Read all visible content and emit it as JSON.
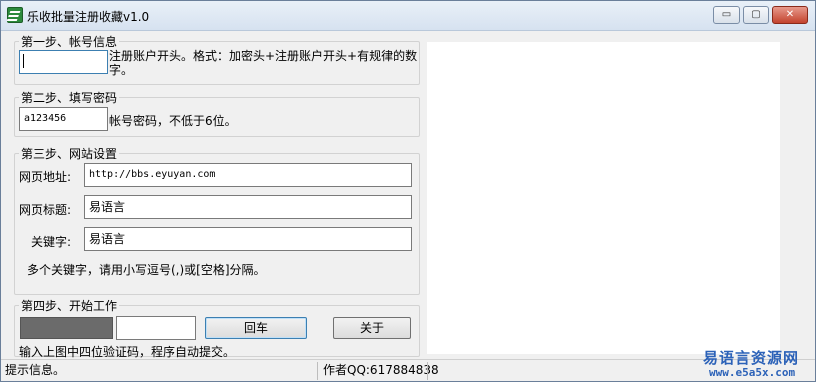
{
  "window": {
    "title": "乐收批量注册收藏v1.0",
    "icon": "app-logo-icon",
    "controls": {
      "minimize": "▭",
      "maximize": "▢",
      "close": "✕"
    }
  },
  "step1": {
    "legend": "第一步、帐号信息",
    "input_value": "",
    "hint_line1": "注册账户开头。格式：加密头+注册账户开头+有规律的数",
    "hint_line2": "字。"
  },
  "step2": {
    "legend": "第二步、填写密码",
    "input_value": "a123456",
    "hint": "帐号密码，不低于6位。"
  },
  "step3": {
    "legend": "第三步、网站设置",
    "url_label": "网页地址:",
    "url_value": "http://bbs.eyuyan.com",
    "title_label": "网页标题:",
    "title_value": "易语言",
    "keyword_label": "关键字:",
    "keyword_value": "易语言",
    "note": "多个关键字，请用小写逗号(,)或[空格]分隔。"
  },
  "step4": {
    "legend": "第四步、开始工作",
    "captcha_value": "",
    "enter_button": "回车",
    "about_button": "关于",
    "instruction": "输入上图中四位验证码，程序自动提交。"
  },
  "status": {
    "info": "提示信息。",
    "author": "作者QQ:617884838"
  },
  "watermark": {
    "line1": "易语言资源网",
    "line2": "www.e5a5x.com"
  },
  "colors": {
    "window_bg": "#f0f0f0",
    "captcha_bg": "#6b6b6b",
    "watermark": "#2c62b8",
    "focus_border": "#3c7fb1"
  }
}
